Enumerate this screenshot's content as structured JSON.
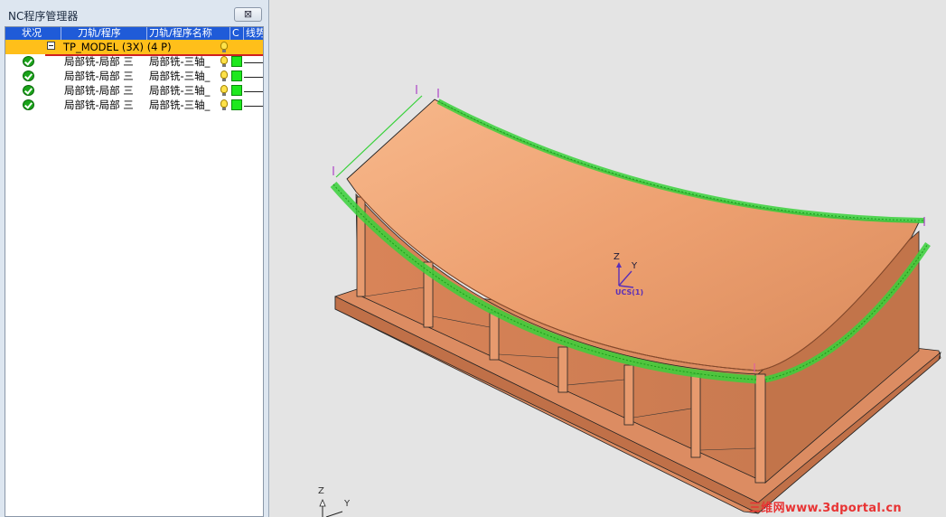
{
  "panel": {
    "title": "NC程序管理器",
    "close_glyph": "⊠"
  },
  "tree": {
    "columns": {
      "status": "状况",
      "toolpath": "刀轨/程序",
      "name": "刀轨/程序名称",
      "c": "C",
      "line": "线势"
    },
    "group": {
      "label": "TP_MODEL (3X) (4 P)"
    },
    "items": [
      {
        "toolpath": "局部铣-局部 三",
        "name": "局部铣-三轴_"
      },
      {
        "toolpath": "局部铣-局部 三",
        "name": "局部铣-三轴_"
      },
      {
        "toolpath": "局部铣-局部 三",
        "name": "局部铣-三轴_"
      },
      {
        "toolpath": "局部铣-局部 三",
        "name": "局部铣-三轴_"
      }
    ]
  },
  "viewport": {
    "ucs_label": "UCS(1)",
    "axis_z": "Z",
    "axis_y": "Y",
    "corner_z": "Z",
    "corner_y": "Y",
    "watermark": "三维网www.3dportal.cn",
    "colors": {
      "part": "#e0966a",
      "part_light": "#f2b58a",
      "part_dark": "#c87a52",
      "toolpath": "#39d13b",
      "ucs": "#5a2fb8"
    }
  }
}
